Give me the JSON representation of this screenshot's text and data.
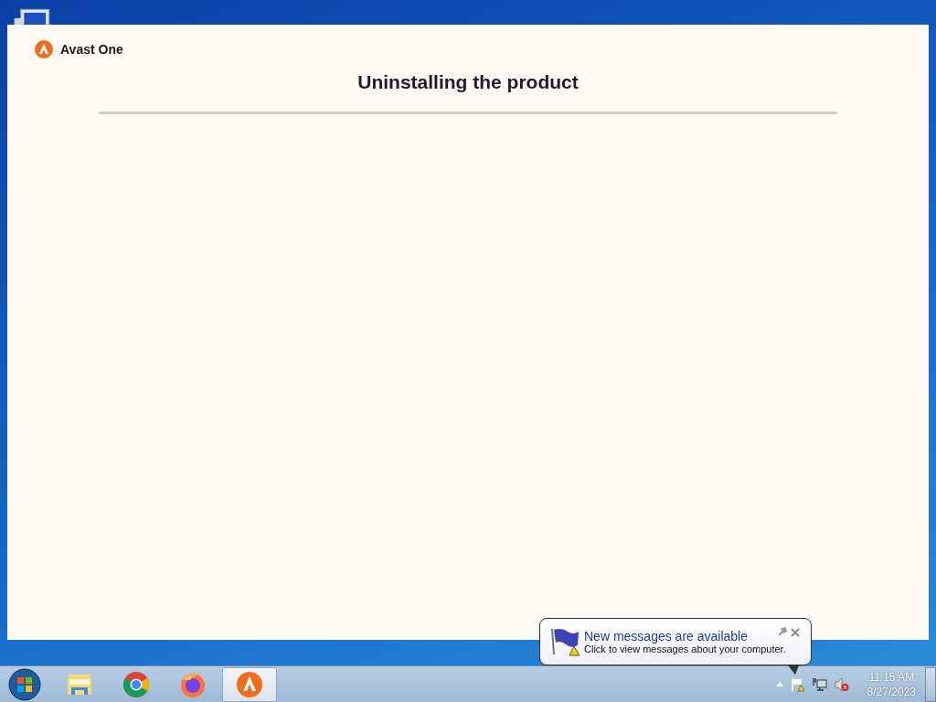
{
  "window": {
    "app_name": "Avast One",
    "title": "Uninstalling the product"
  },
  "notification": {
    "title": "New messages are available",
    "message": "Click to view messages about your computer."
  },
  "taskbar": {
    "apps": [
      {
        "kind": "explorer",
        "selected": false
      },
      {
        "kind": "chrome",
        "selected": false
      },
      {
        "kind": "firefox",
        "selected": false
      },
      {
        "kind": "avast",
        "selected": true
      }
    ],
    "clock": {
      "time": "11:15 AM",
      "date": "8/27/2023"
    }
  }
}
